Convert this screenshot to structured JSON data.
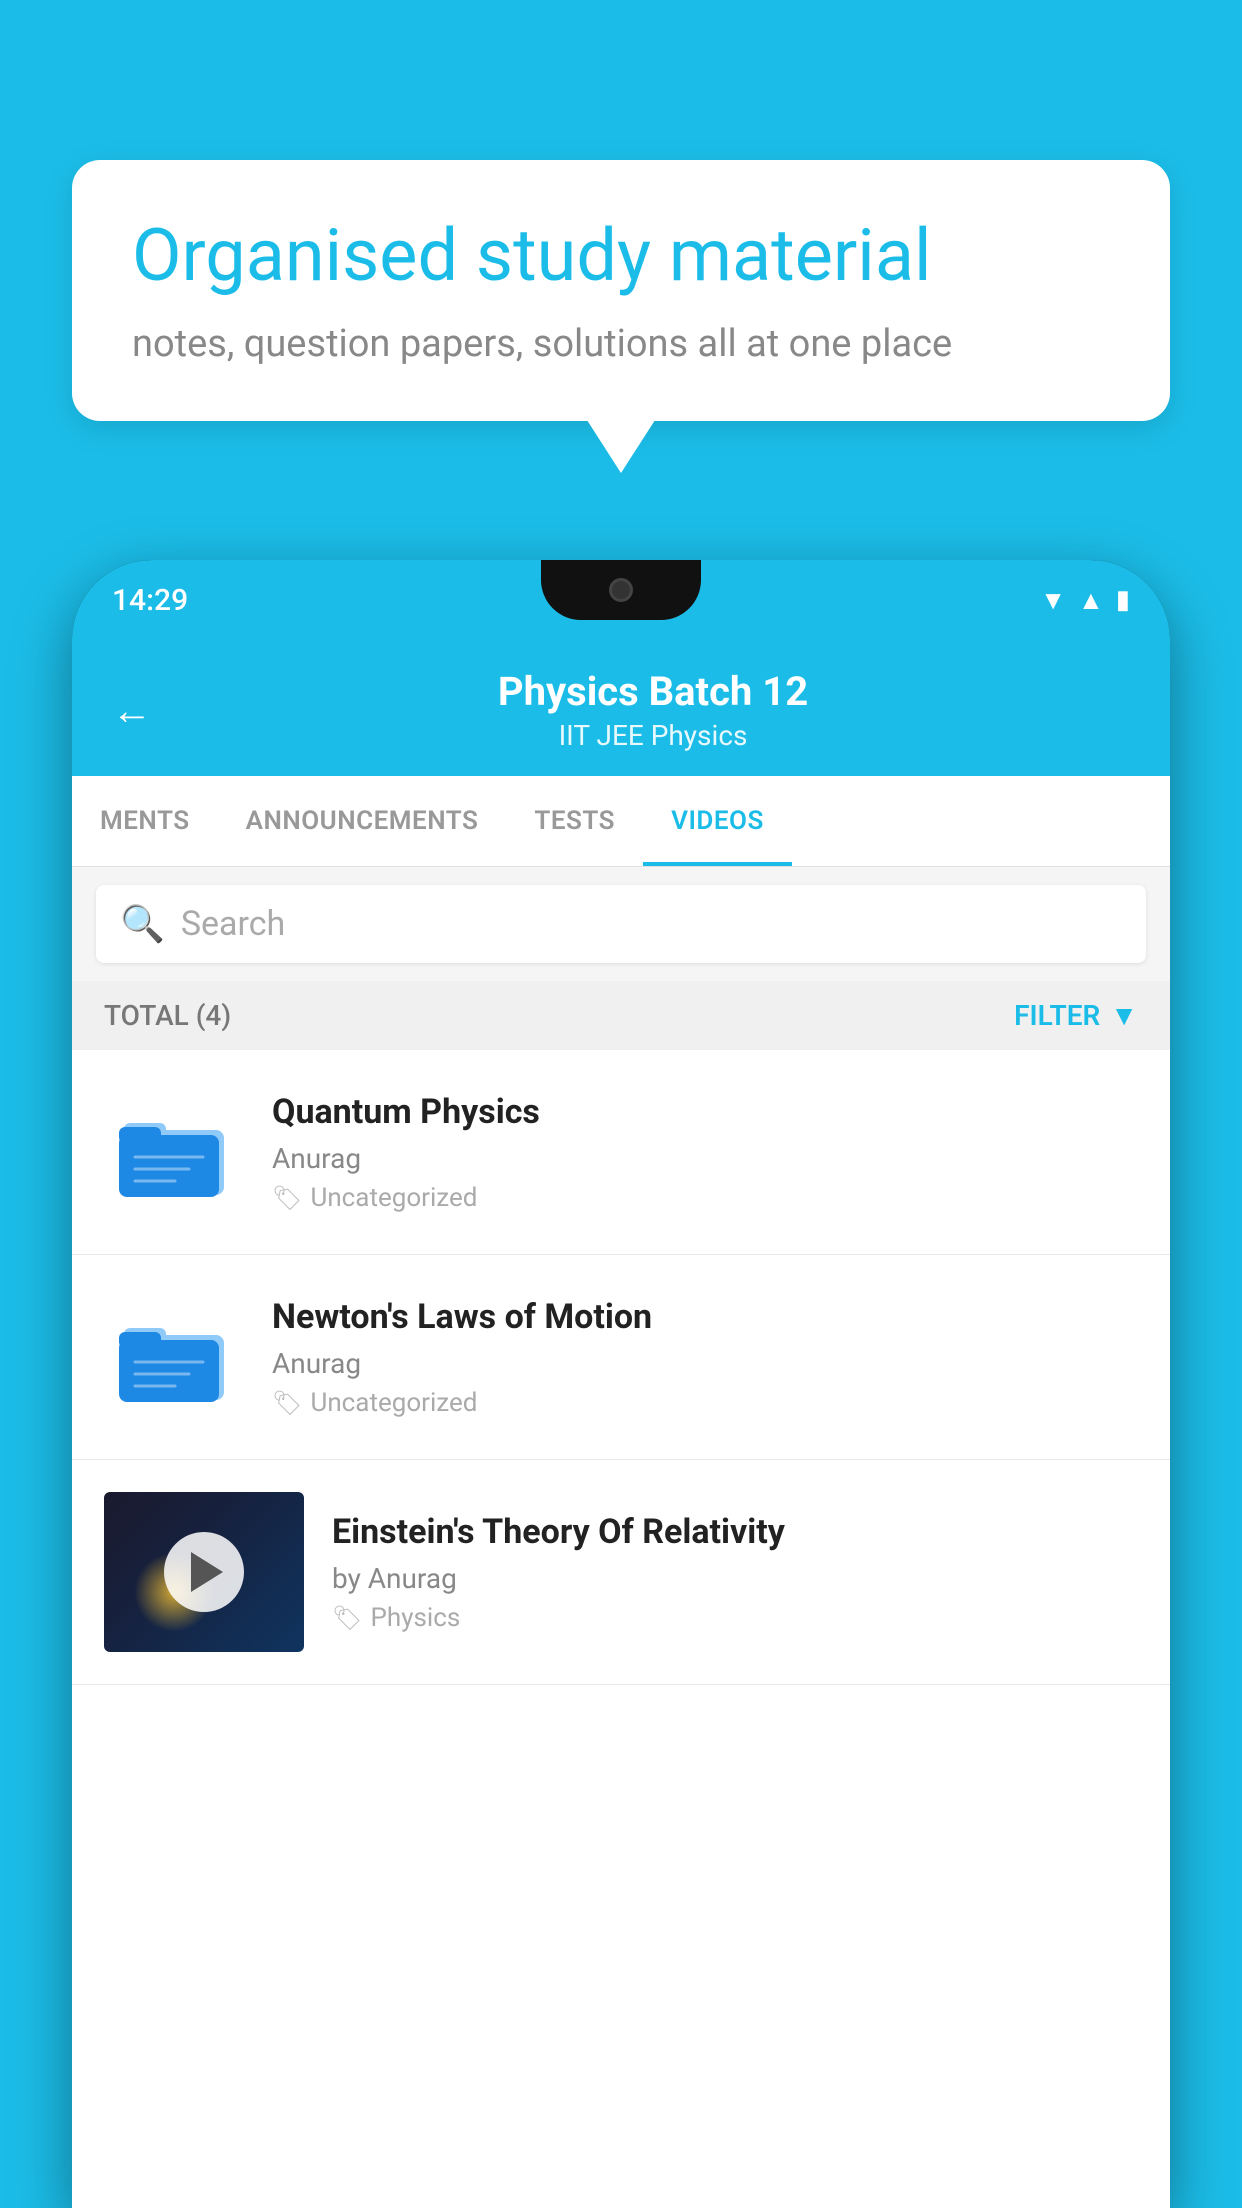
{
  "bubble": {
    "title": "Organised study material",
    "subtitle": "notes, question papers, solutions all at one place"
  },
  "status_bar": {
    "time": "14:29"
  },
  "header": {
    "title": "Physics Batch 12",
    "subtitle": "IIT JEE   Physics",
    "back_label": "←"
  },
  "tabs": [
    {
      "label": "MENTS",
      "active": false
    },
    {
      "label": "ANNOUNCEMENTS",
      "active": false
    },
    {
      "label": "TESTS",
      "active": false
    },
    {
      "label": "VIDEOS",
      "active": true
    }
  ],
  "search": {
    "placeholder": "Search"
  },
  "filter_bar": {
    "total_label": "TOTAL (4)",
    "filter_label": "FILTER"
  },
  "videos": [
    {
      "id": "1",
      "title": "Quantum Physics",
      "author": "Anurag",
      "tag": "Uncategorized",
      "type": "folder"
    },
    {
      "id": "2",
      "title": "Newton's Laws of Motion",
      "author": "Anurag",
      "tag": "Uncategorized",
      "type": "folder"
    },
    {
      "id": "3",
      "title": "Einstein's Theory Of Relativity",
      "author": "by Anurag",
      "tag": "Physics",
      "type": "video"
    }
  ]
}
